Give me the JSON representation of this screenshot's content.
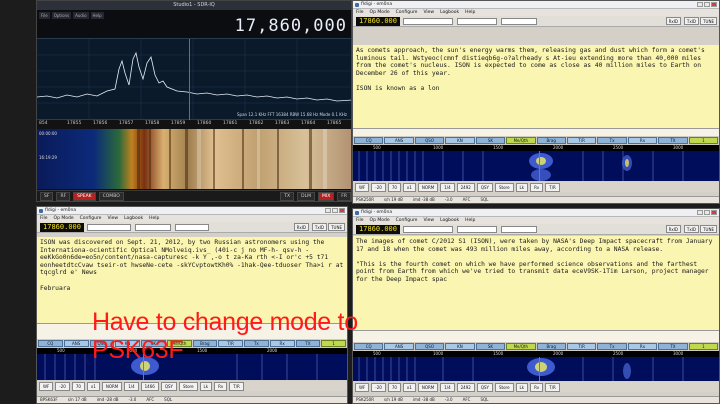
{
  "sdr": {
    "title": "Studio1 - SDR-IQ",
    "menu": [
      "File",
      "Options",
      "Audio",
      "Help"
    ],
    "frequency": "17,860,000",
    "status": "Span 12.1 KHz   FFT 16384   RBW 15.68 Hz   Mode 0.1 KHz",
    "scale": [
      "854",
      "17855",
      "17856",
      "17857",
      "17858",
      "17859",
      "17860",
      "17861",
      "17862",
      "17863",
      "17864",
      "17865"
    ],
    "time_labels": [
      "00:00:00",
      "16:19:29"
    ],
    "bottom": [
      "SF",
      "RF",
      "SPEAK",
      "COMBO",
      "TX",
      "DLM",
      "MIX",
      "FR"
    ]
  },
  "fl1": {
    "title": "fldigi - em0na",
    "menu": [
      "File",
      "Op Mode",
      "Configure",
      "View",
      "Logbook",
      "Help"
    ],
    "freq": "17860.000",
    "rx_text": "As comets approach, the sun's energy warms them, releasing gas and dust which form a comet's luminous tail. Wstyeoc(cmnf distieqb6g-o?alrheady s At-ieu extending more than 40,000 miles from the comet's nucleus. ISON is expected to come as close as 40 million miles to Earth on December 26 of this year.\n\nISON is known as a lon",
    "macros": [
      "CQ",
      "ANS",
      "QSO",
      "KN",
      "SK",
      "Me/Qth",
      "Brag",
      "T/R",
      "Tx",
      "Rx",
      "TX",
      "1"
    ],
    "scale": [
      "500",
      "1000",
      "1500",
      "2000",
      "2500",
      "3000"
    ],
    "ctrl": [
      "WF",
      "-20",
      "70",
      "x1",
      "NORM",
      "1/4",
      "2492",
      "QSY",
      "Store",
      "Lk",
      "Rv",
      "T/R"
    ],
    "status": [
      "PSK250R",
      "s/n 19 dB",
      "imd -38 dB",
      "-3.0",
      "AFC",
      "SQL"
    ]
  },
  "fl2": {
    "title": "fldigi - em0na",
    "menu": [
      "File",
      "Op Mode",
      "Configure",
      "View",
      "Logbook",
      "Help"
    ],
    "freq": "17860.000",
    "rx_text": "ISON was discovered on Sept. 21, 2012, by two Russian astronomers using the Internationa-ocientific Optical NMolveiq.ivs_ (40i-c j no MF-h- qsv-h -eeKkGo0n6de=eo5n/content/nasa-capturesc -k Y ,-o t za-Ka rth <-I or'c +5 t71  eonheetdtcCvaw tseir-ot hwseNe-cete -skYCvptowtKh0% -1hak-Qee-tduoser Tha>i r at  tqcglrd e' News\n\nFebruara",
    "macros": [
      "CQ",
      "ANS",
      "QSO",
      "KN",
      "SK",
      "Me/Qth",
      "Brag",
      "T/R",
      "Tx",
      "Rx",
      "TX",
      "1"
    ],
    "scale": [
      "500",
      "1000",
      "1500",
      "2000"
    ],
    "ctrl": [
      "WF",
      "-20",
      "70",
      "x1",
      "NORM",
      "1/4",
      "1466",
      "QSY",
      "Store",
      "Lk",
      "Rv",
      "T/R"
    ],
    "status": [
      "BPSK63F",
      "s/n 17 dB",
      "imd -28 dB",
      "-3.0",
      "AFC",
      "SQL"
    ]
  },
  "fl3": {
    "title": "fldigi - em0na",
    "menu": [
      "File",
      "Op Mode",
      "Configure",
      "View",
      "Logbook",
      "Help"
    ],
    "freq": "17860.000",
    "rx_text": "The images of comet C/2012 S1 (ISON), were taken by NASA's Deep Impact spacecraft from January 17 and 18 when the comet was 493 million miles away, according to a NASA release.\n\n\"This is the fourth comet on which we have performed science observations and the farthest point from Earth from which we've tried to transmit data eceV9SK-1Tim Larson, project manager for the Deep Impact spac",
    "macros": [
      "CQ",
      "ANS",
      "QSO",
      "KN",
      "SK",
      "Me/Qth",
      "Brag",
      "T/R",
      "Tx",
      "Rx",
      "TX",
      "1"
    ],
    "scale": [
      "500",
      "1000",
      "1500",
      "2000",
      "2500",
      "3000"
    ],
    "ctrl": [
      "WF",
      "-20",
      "70",
      "x1",
      "NORM",
      "1/4",
      "2492",
      "QSY",
      "Store",
      "Lk",
      "Rv",
      "T/R"
    ],
    "status": [
      "PSK250R",
      "s/n 19 dB",
      "imd -38 dB",
      "-3.0",
      "AFC",
      "SQL"
    ]
  },
  "annotation": "Have to change mode to PSK63F"
}
